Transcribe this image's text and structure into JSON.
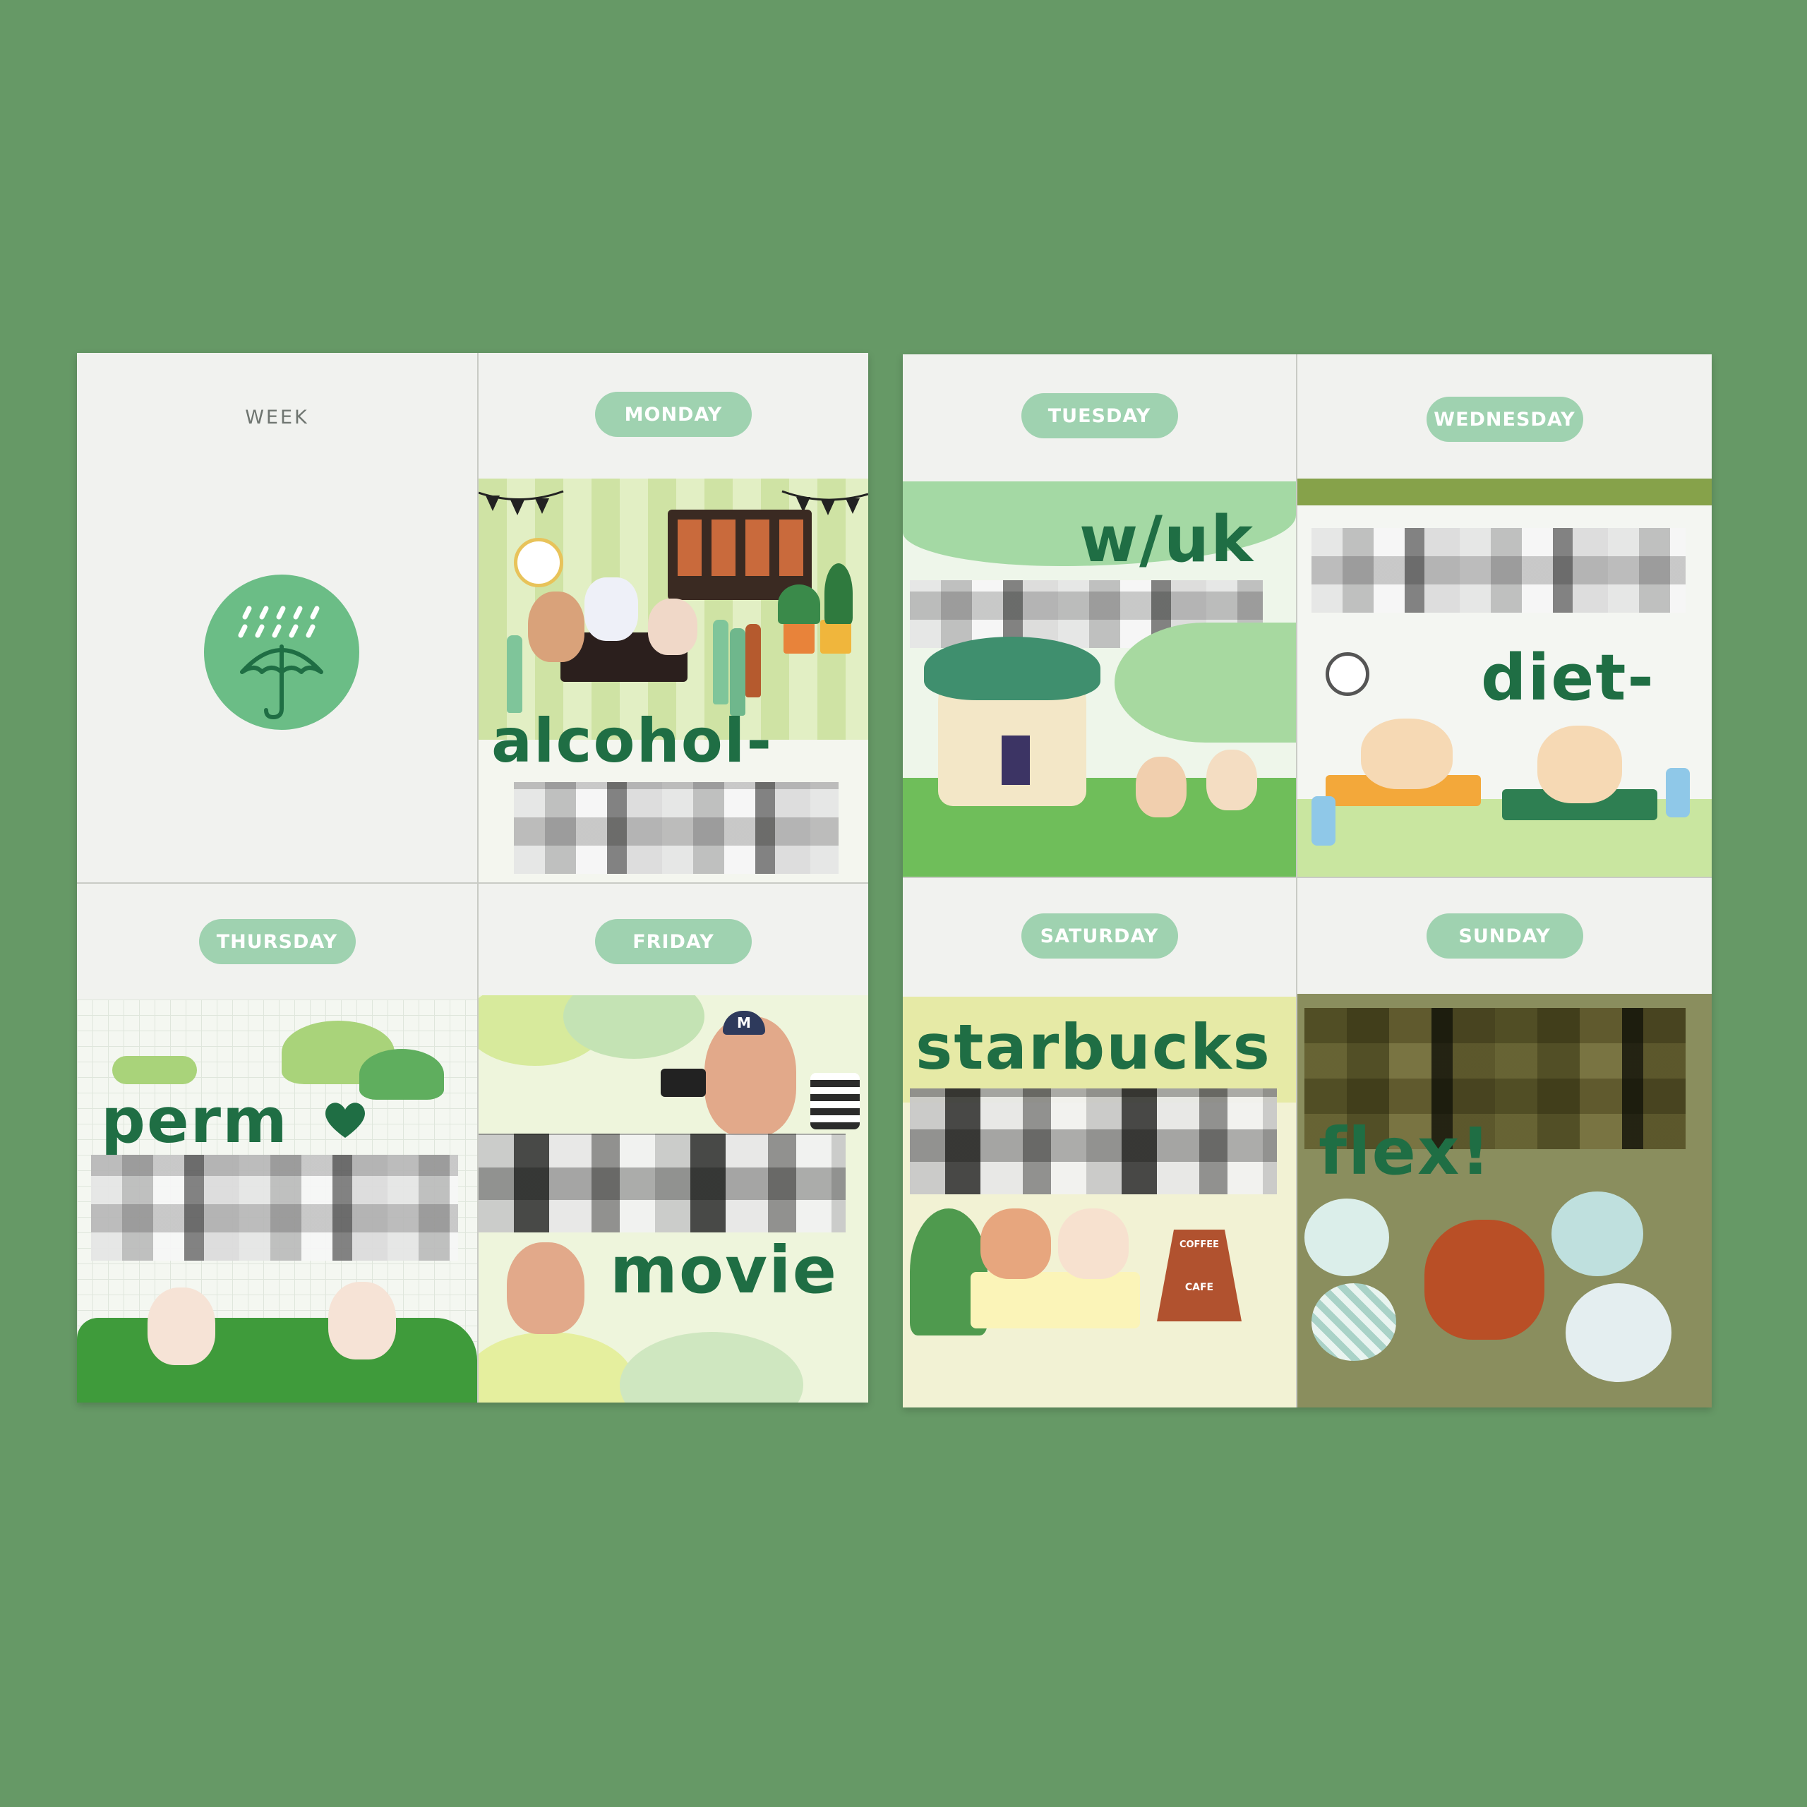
{
  "left_page": {
    "week_label": "WEEK",
    "days": {
      "monday": {
        "label": "MONDAY",
        "caption": "alcohol-"
      },
      "thursday": {
        "label": "THURSDAY",
        "caption": "perm"
      },
      "friday": {
        "label": "FRIDAY",
        "caption": "movie"
      }
    }
  },
  "right_page": {
    "days": {
      "tuesday": {
        "label": "TUESDAY",
        "caption": "w/uk"
      },
      "wednesday": {
        "label": "WEDNESDAY",
        "caption": "diet-"
      },
      "saturday": {
        "label": "SATURDAY",
        "caption": "starbucks"
      },
      "sunday": {
        "label": "SUNDAY",
        "caption": "flex!"
      }
    }
  },
  "sticker_text": {
    "cafe_sign_top": "COFFEE",
    "cafe_sign_bottom": "CAFE",
    "cap_letter": "M"
  },
  "icons": {
    "week_weather": "rain-umbrella-icon"
  },
  "colors": {
    "background": "#669966",
    "paper": "#f1f2ef",
    "pill": "#9fd2b0",
    "handwriting": "#1f6e44"
  }
}
